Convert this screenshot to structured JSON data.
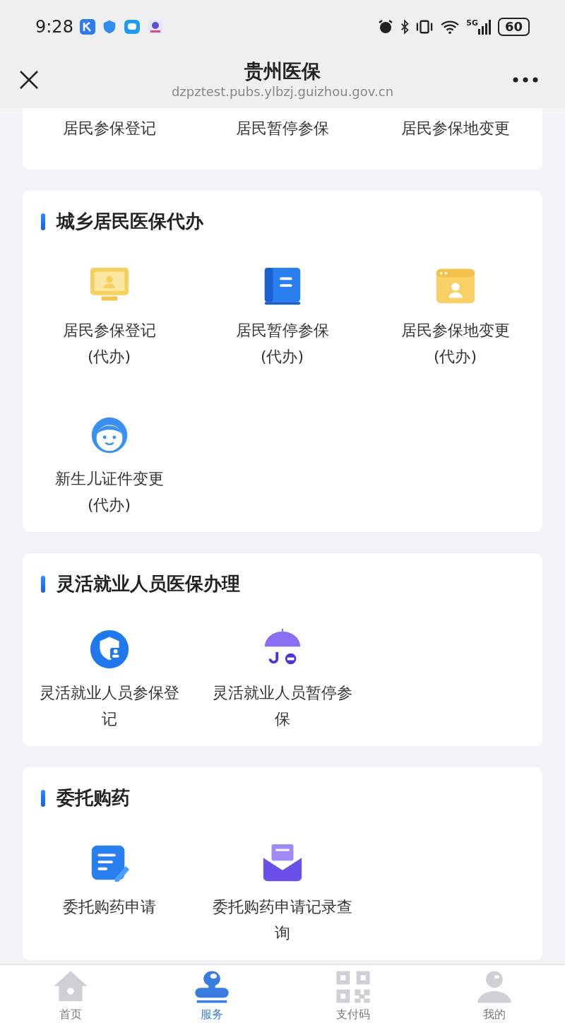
{
  "status_bar": {
    "time": "9:28",
    "network": "5G",
    "battery": "60"
  },
  "header": {
    "title": "贵州医保",
    "url": "dzpztest.pubs.ylbzj.guizhou.gov.cn"
  },
  "sections": [
    {
      "items": [
        {
          "label": "居民参保登记"
        },
        {
          "label": "居民暂停参保"
        },
        {
          "label": "居民参保地变更"
        }
      ]
    },
    {
      "title": "城乡居民医保代办",
      "items": [
        {
          "kind": "monitor",
          "label": "居民参保登记",
          "sub": "(代办)"
        },
        {
          "kind": "book",
          "label": "居民暂停参保",
          "sub": "(代办)"
        },
        {
          "kind": "window",
          "label": "居民参保地变更",
          "sub": "(代办)"
        },
        {
          "kind": "baby",
          "label": "新生儿证件变更",
          "sub": "(代办)"
        }
      ]
    },
    {
      "title": "灵活就业人员医保办理",
      "items": [
        {
          "kind": "shield",
          "label": "灵活就业人员参保登记"
        },
        {
          "kind": "umbrella",
          "label": "灵活就业人员暂停参保"
        }
      ]
    },
    {
      "title": "委托购药",
      "items": [
        {
          "kind": "note",
          "label": "委托购药申请"
        },
        {
          "kind": "mail",
          "label": "委托购药申请记录查询"
        }
      ]
    }
  ],
  "tabs": [
    {
      "kind": "home",
      "label": "首页",
      "selected": false
    },
    {
      "kind": "stamp",
      "label": "服务",
      "selected": true
    },
    {
      "kind": "qr",
      "label": "支付码",
      "selected": false
    },
    {
      "kind": "person",
      "label": "我的",
      "selected": false
    }
  ]
}
